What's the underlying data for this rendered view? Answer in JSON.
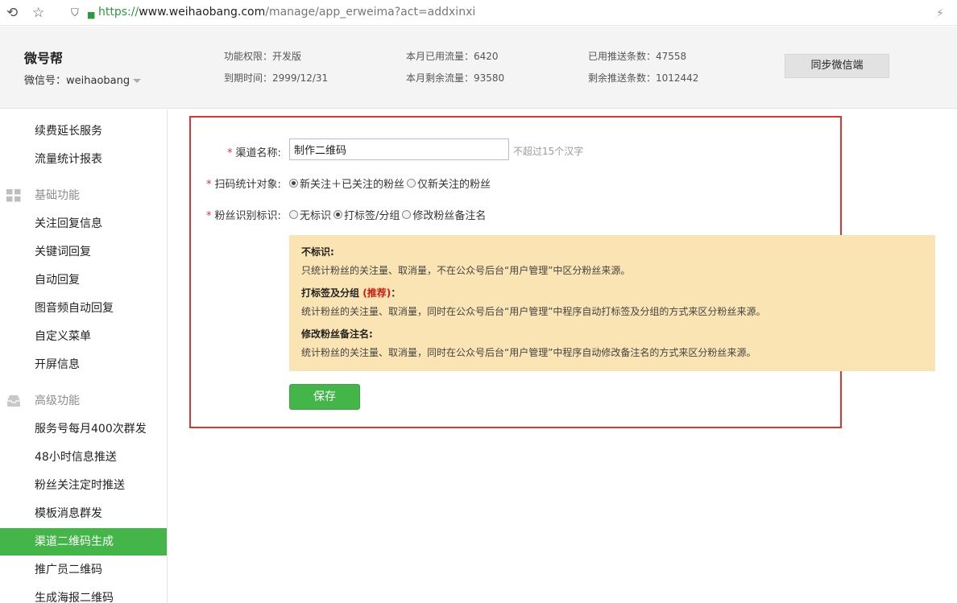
{
  "browser": {
    "url_scheme": "https://",
    "url_domain": "www.weihaobang.com",
    "url_path": "/manage/app_erweima?act=addxinxi"
  },
  "header": {
    "account_name": "微号帮",
    "account_id": "微信号：weihaobang",
    "stats": {
      "permission": "功能权限：开发版",
      "expire": "到期时间：2999/12/31",
      "flow_used": "本月已用流量：6420",
      "flow_remain": "本月剩余流量：93580",
      "push_used": "已用推送条数：47558",
      "push_remain": "剩余推送条数：1012442"
    },
    "sync_button": "同步微信端"
  },
  "sidebar": {
    "top_items": [
      "续费延长服务",
      "流量统计报表"
    ],
    "group_basic": "基础功能",
    "basic_items": [
      "关注回复信息",
      "关键词回复",
      "自动回复",
      "图音频自动回复",
      "自定义菜单",
      "开屏信息"
    ],
    "group_advanced": "高级功能",
    "advanced_items": [
      "服务号每月400次群发",
      "48小时信息推送",
      "粉丝关注定时推送",
      "模板消息群发",
      "渠道二维码生成",
      "推广员二维码",
      "生成海报二维码"
    ],
    "active_item": "渠道二维码生成"
  },
  "form": {
    "required_mark": "*",
    "channel_label": "渠道名称:",
    "channel_value": "制作二维码",
    "channel_hint": "不超过15个汉字",
    "scan_label": "扫码统计对象:",
    "scan_options": [
      "新关注＋已关注的粉丝",
      "仅新关注的粉丝"
    ],
    "fan_label": "粉丝识别标识:",
    "fan_options": [
      "无标识",
      "打标签/分组",
      "修改粉丝备注名"
    ],
    "info": {
      "t1": "不标识:",
      "d1": "只统计粉丝的关注量、取消量，不在公众号后台“用户管理”中区分粉丝来源。",
      "t2": "打标签及分组",
      "t2_em": "(推荐)",
      "t2_tail": "：",
      "d2": "统计粉丝的关注量、取消量，同时在公众号后台“用户管理”中程序自动打标签及分组的方式来区分粉丝来源。",
      "t3": "修改粉丝备注名:",
      "d3": "统计粉丝的关注量、取消量，同时在公众号后台“用户管理”中程序自动修改备注名的方式来区分粉丝来源。"
    },
    "save_button": "保存"
  }
}
